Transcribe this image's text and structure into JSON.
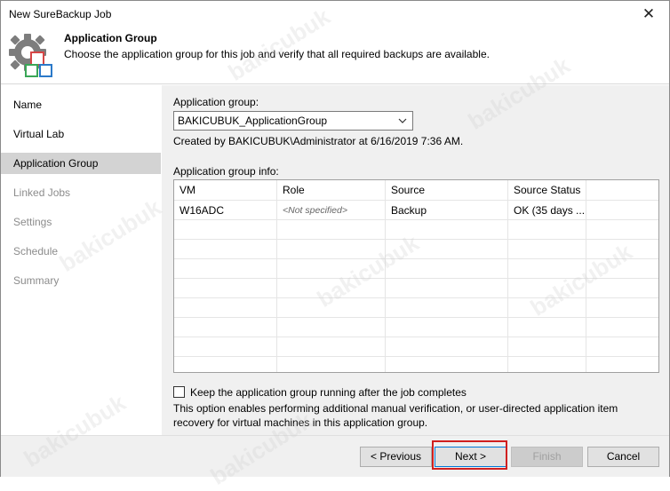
{
  "window": {
    "title": "New SureBackup Job",
    "close_glyph": "✕"
  },
  "header": {
    "title": "Application Group",
    "description": "Choose the application group for this job and verify that all required backups are available.",
    "icon": "gear-icon"
  },
  "steps": [
    {
      "label": "Name",
      "state": "normal"
    },
    {
      "label": "Virtual Lab",
      "state": "normal"
    },
    {
      "label": "Application Group",
      "state": "active"
    },
    {
      "label": "Linked Jobs",
      "state": "disabled"
    },
    {
      "label": "Settings",
      "state": "disabled"
    },
    {
      "label": "Schedule",
      "state": "disabled"
    },
    {
      "label": "Summary",
      "state": "disabled"
    }
  ],
  "content": {
    "app_group_label": "Application group:",
    "app_group_value": "BAKICUBUK_ApplicationGroup",
    "created_by": "Created by BAKICUBUK\\Administrator at 6/16/2019 7:36 AM.",
    "info_label": "Application group info:",
    "table": {
      "columns": [
        "VM",
        "Role",
        "Source",
        "Source Status"
      ],
      "rows": [
        [
          "W16ADC",
          "<Not specified>",
          "Backup",
          "OK (35 days ..."
        ]
      ]
    },
    "keep_running_label": "Keep the application group running after the job completes",
    "keep_running_checked": false,
    "option_desc_line1": "This option enables performing additional manual verification, or user-directed application item",
    "option_desc_line2": "recovery for virtual machines in this application group."
  },
  "buttons": {
    "previous": "< Previous",
    "next": "Next >",
    "finish": "Finish",
    "cancel": "Cancel"
  },
  "watermark": "bakicubuk"
}
